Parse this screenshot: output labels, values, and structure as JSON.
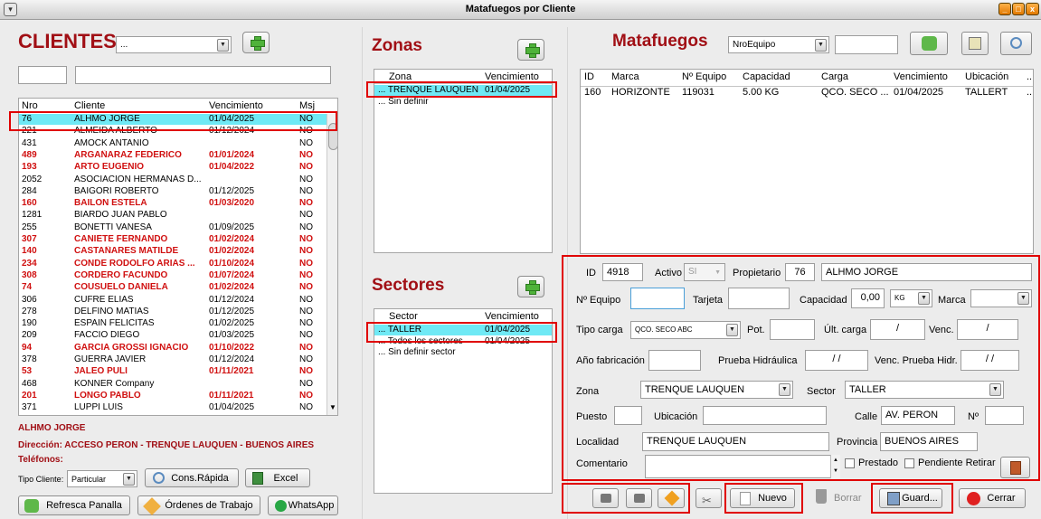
{
  "window": {
    "title": "Matafuegos por Cliente"
  },
  "clientes": {
    "title": "CLIENTES",
    "filter_combo": "...",
    "search_short": "",
    "search_long": "",
    "columns": [
      "Nro",
      "Cliente",
      "Vencimiento",
      "Msj"
    ],
    "rows": [
      {
        "nro": "76",
        "cliente": "ALHMO JORGE",
        "venc": "01/04/2025",
        "msj": "NO",
        "red": false,
        "selected": true
      },
      {
        "nro": "221",
        "cliente": "ALMEIDA ALBERTO",
        "venc": "01/12/2024",
        "msj": "NO",
        "red": false
      },
      {
        "nro": "431",
        "cliente": "AMOCK ANTANIO",
        "venc": "",
        "msj": "NO",
        "red": false
      },
      {
        "nro": "489",
        "cliente": "ARGAÑARAZ FEDERICO",
        "venc": "01/01/2024",
        "msj": "NO",
        "red": true
      },
      {
        "nro": "193",
        "cliente": "ARTO EUGENIO",
        "venc": "01/04/2022",
        "msj": "NO",
        "red": true
      },
      {
        "nro": "2052",
        "cliente": "ASOCIACION HERMANAS D...",
        "venc": "",
        "msj": "NO",
        "red": false
      },
      {
        "nro": "284",
        "cliente": "BAIGORI ROBERTO",
        "venc": "01/12/2025",
        "msj": "NO",
        "red": false
      },
      {
        "nro": "160",
        "cliente": "BAILON ESTELA",
        "venc": "01/03/2020",
        "msj": "NO",
        "red": true
      },
      {
        "nro": "1281",
        "cliente": "BIARDO JUAN PABLO",
        "venc": "",
        "msj": "NO",
        "red": false
      },
      {
        "nro": "255",
        "cliente": "BONETTI VANESA",
        "venc": "01/09/2025",
        "msj": "NO",
        "red": false
      },
      {
        "nro": "307",
        "cliente": "CANIETE FERNANDO",
        "venc": "01/02/2024",
        "msj": "NO",
        "red": true
      },
      {
        "nro": "140",
        "cliente": "CASTAÑARES MATILDE",
        "venc": "01/02/2024",
        "msj": "NO",
        "red": true
      },
      {
        "nro": "234",
        "cliente": "CONDE RODOLFO ARIAS ...",
        "venc": "01/10/2024",
        "msj": "NO",
        "red": true
      },
      {
        "nro": "308",
        "cliente": "CORDERO FACUNDO",
        "venc": "01/07/2024",
        "msj": "NO",
        "red": true
      },
      {
        "nro": "74",
        "cliente": "COUSUELO DANIELA",
        "venc": "01/02/2024",
        "msj": "NO",
        "red": true
      },
      {
        "nro": "306",
        "cliente": "CUFRE ELIAS",
        "venc": "01/12/2024",
        "msj": "NO",
        "red": false
      },
      {
        "nro": "278",
        "cliente": "DELFINO MATIAS",
        "venc": "01/12/2025",
        "msj": "NO",
        "red": false
      },
      {
        "nro": "190",
        "cliente": "ESPAIN FELICITAS",
        "venc": "01/02/2025",
        "msj": "NO",
        "red": false
      },
      {
        "nro": "209",
        "cliente": "FACCIO DIEGO",
        "venc": "01/03/2025",
        "msj": "NO",
        "red": false
      },
      {
        "nro": "94",
        "cliente": "GARCIA GROSSI IGNACIO",
        "venc": "01/10/2022",
        "msj": "NO",
        "red": true
      },
      {
        "nro": "378",
        "cliente": "GUERRA JAVIER",
        "venc": "01/12/2024",
        "msj": "NO",
        "red": false
      },
      {
        "nro": "53",
        "cliente": "JALEO PULI",
        "venc": "01/11/2021",
        "msj": "NO",
        "red": true
      },
      {
        "nro": "468",
        "cliente": "KONNER Company",
        "venc": "",
        "msj": "NO",
        "red": false
      },
      {
        "nro": "201",
        "cliente": "LONGO PABLO",
        "venc": "01/11/2021",
        "msj": "NO",
        "red": true
      },
      {
        "nro": "371",
        "cliente": "LUPPI LUIS",
        "venc": "01/04/2025",
        "msj": "NO",
        "red": false
      }
    ],
    "info_name": "ALHMO JORGE",
    "info_address": "Dirección: ACCESO PERON  - TRENQUE LAUQUEN - BUENOS AIRES",
    "info_phones": "Teléfonos:",
    "tipo_cliente_label": "Tipo Cliente:",
    "tipo_cliente_value": "Particular",
    "cons_rapida": "Cons.Rápida",
    "excel": "Excel",
    "refresca": "Refresca Panalla",
    "ordenes": "Órdenes de Trabajo",
    "whatsapp": "WhatsApp"
  },
  "zonas": {
    "title": "Zonas",
    "columns": [
      "Zona",
      "Vencimiento"
    ],
    "rows": [
      {
        "name": "... TRENQUE LAUQUEN",
        "venc": "01/04/2025",
        "selected": true
      },
      {
        "name": "... Sin definir",
        "venc": ""
      }
    ]
  },
  "sectores": {
    "title": "Sectores",
    "columns": [
      "Sector",
      "Vencimiento"
    ],
    "rows": [
      {
        "name": "... TALLER",
        "venc": "01/04/2025",
        "selected": true
      },
      {
        "name": "... Todos los sectores",
        "venc": "01/04/2025"
      },
      {
        "name": "... Sin definir sector",
        "venc": ""
      }
    ]
  },
  "matafuegos": {
    "title": "Matafuegos",
    "order_combo": "NroEquipo",
    "search": "",
    "columns": [
      "ID",
      "Marca",
      "Nº Equipo",
      "Capacidad",
      "Carga",
      "Vencimiento",
      "Ubicación",
      "..."
    ],
    "rows": [
      {
        "id": "160",
        "marca": "HORIZONTE",
        "equipo": "119031",
        "capacidad": "5.00 KG",
        "carga": "QCO. SECO ...",
        "venc": "01/04/2025",
        "ubic": "TALLERT",
        "more": "..."
      }
    ]
  },
  "form": {
    "id_label": "ID",
    "id_value": "4918",
    "activo_label": "Activo",
    "activo_value": "SI",
    "propietario_label": "Propietario",
    "propietario_nro": "76",
    "propietario_name": "ALHMO JORGE",
    "equipo_label": "Nº Equipo",
    "equipo_value": "",
    "tarjeta_label": "Tarjeta",
    "tarjeta_value": "",
    "capacidad_label": "Capacidad",
    "capacidad_value": "0,00",
    "unidad_value": "KG",
    "marca_label": "Marca",
    "marca_value": "",
    "tipo_carga_label": "Tipo carga",
    "tipo_carga_value": "QCO. SECO ABC",
    "pot_label": "Pot.",
    "pot_value": "",
    "ult_carga_label": "Últ. carga",
    "ult_carga_value": "/",
    "venc_label": "Venc.",
    "venc_value": "/",
    "anio_label": "Año fabricación",
    "anio_value": "",
    "prueba_label": "Prueba Hidráulica",
    "prueba_value": "/ /",
    "venc_prueba_label": "Venc. Prueba Hidr.",
    "venc_prueba_value": "/ /",
    "zona_label": "Zona",
    "zona_value": "TRENQUE LAUQUEN",
    "sector_label": "Sector",
    "sector_value": "TALLER",
    "puesto_label": "Puesto",
    "puesto_value": "",
    "ubicacion_label": "Ubicación",
    "ubicacion_value": "",
    "calle_label": "Calle",
    "calle_value": "AV. PERON",
    "nro_label": "Nº",
    "nro_value": "",
    "localidad_label": "Localidad",
    "localidad_value": "TRENQUE LAUQUEN",
    "provincia_label": "Provincia",
    "provincia_value": "BUENOS AIRES",
    "comentario_label": "Comentario",
    "comentario_value": "",
    "prestado_label": "Prestado",
    "pendiente_label": "Pendiente Retirar"
  },
  "actions": {
    "nuevo": "Nuevo",
    "borrar": "Borrar",
    "guardar": "Guard...",
    "cerrar": "Cerrar"
  },
  "colors": {
    "accent_red": "#a10f15",
    "expired_red": "#d01010",
    "selected_row": "#6fe9f5",
    "highlight_box": "#e00000"
  }
}
